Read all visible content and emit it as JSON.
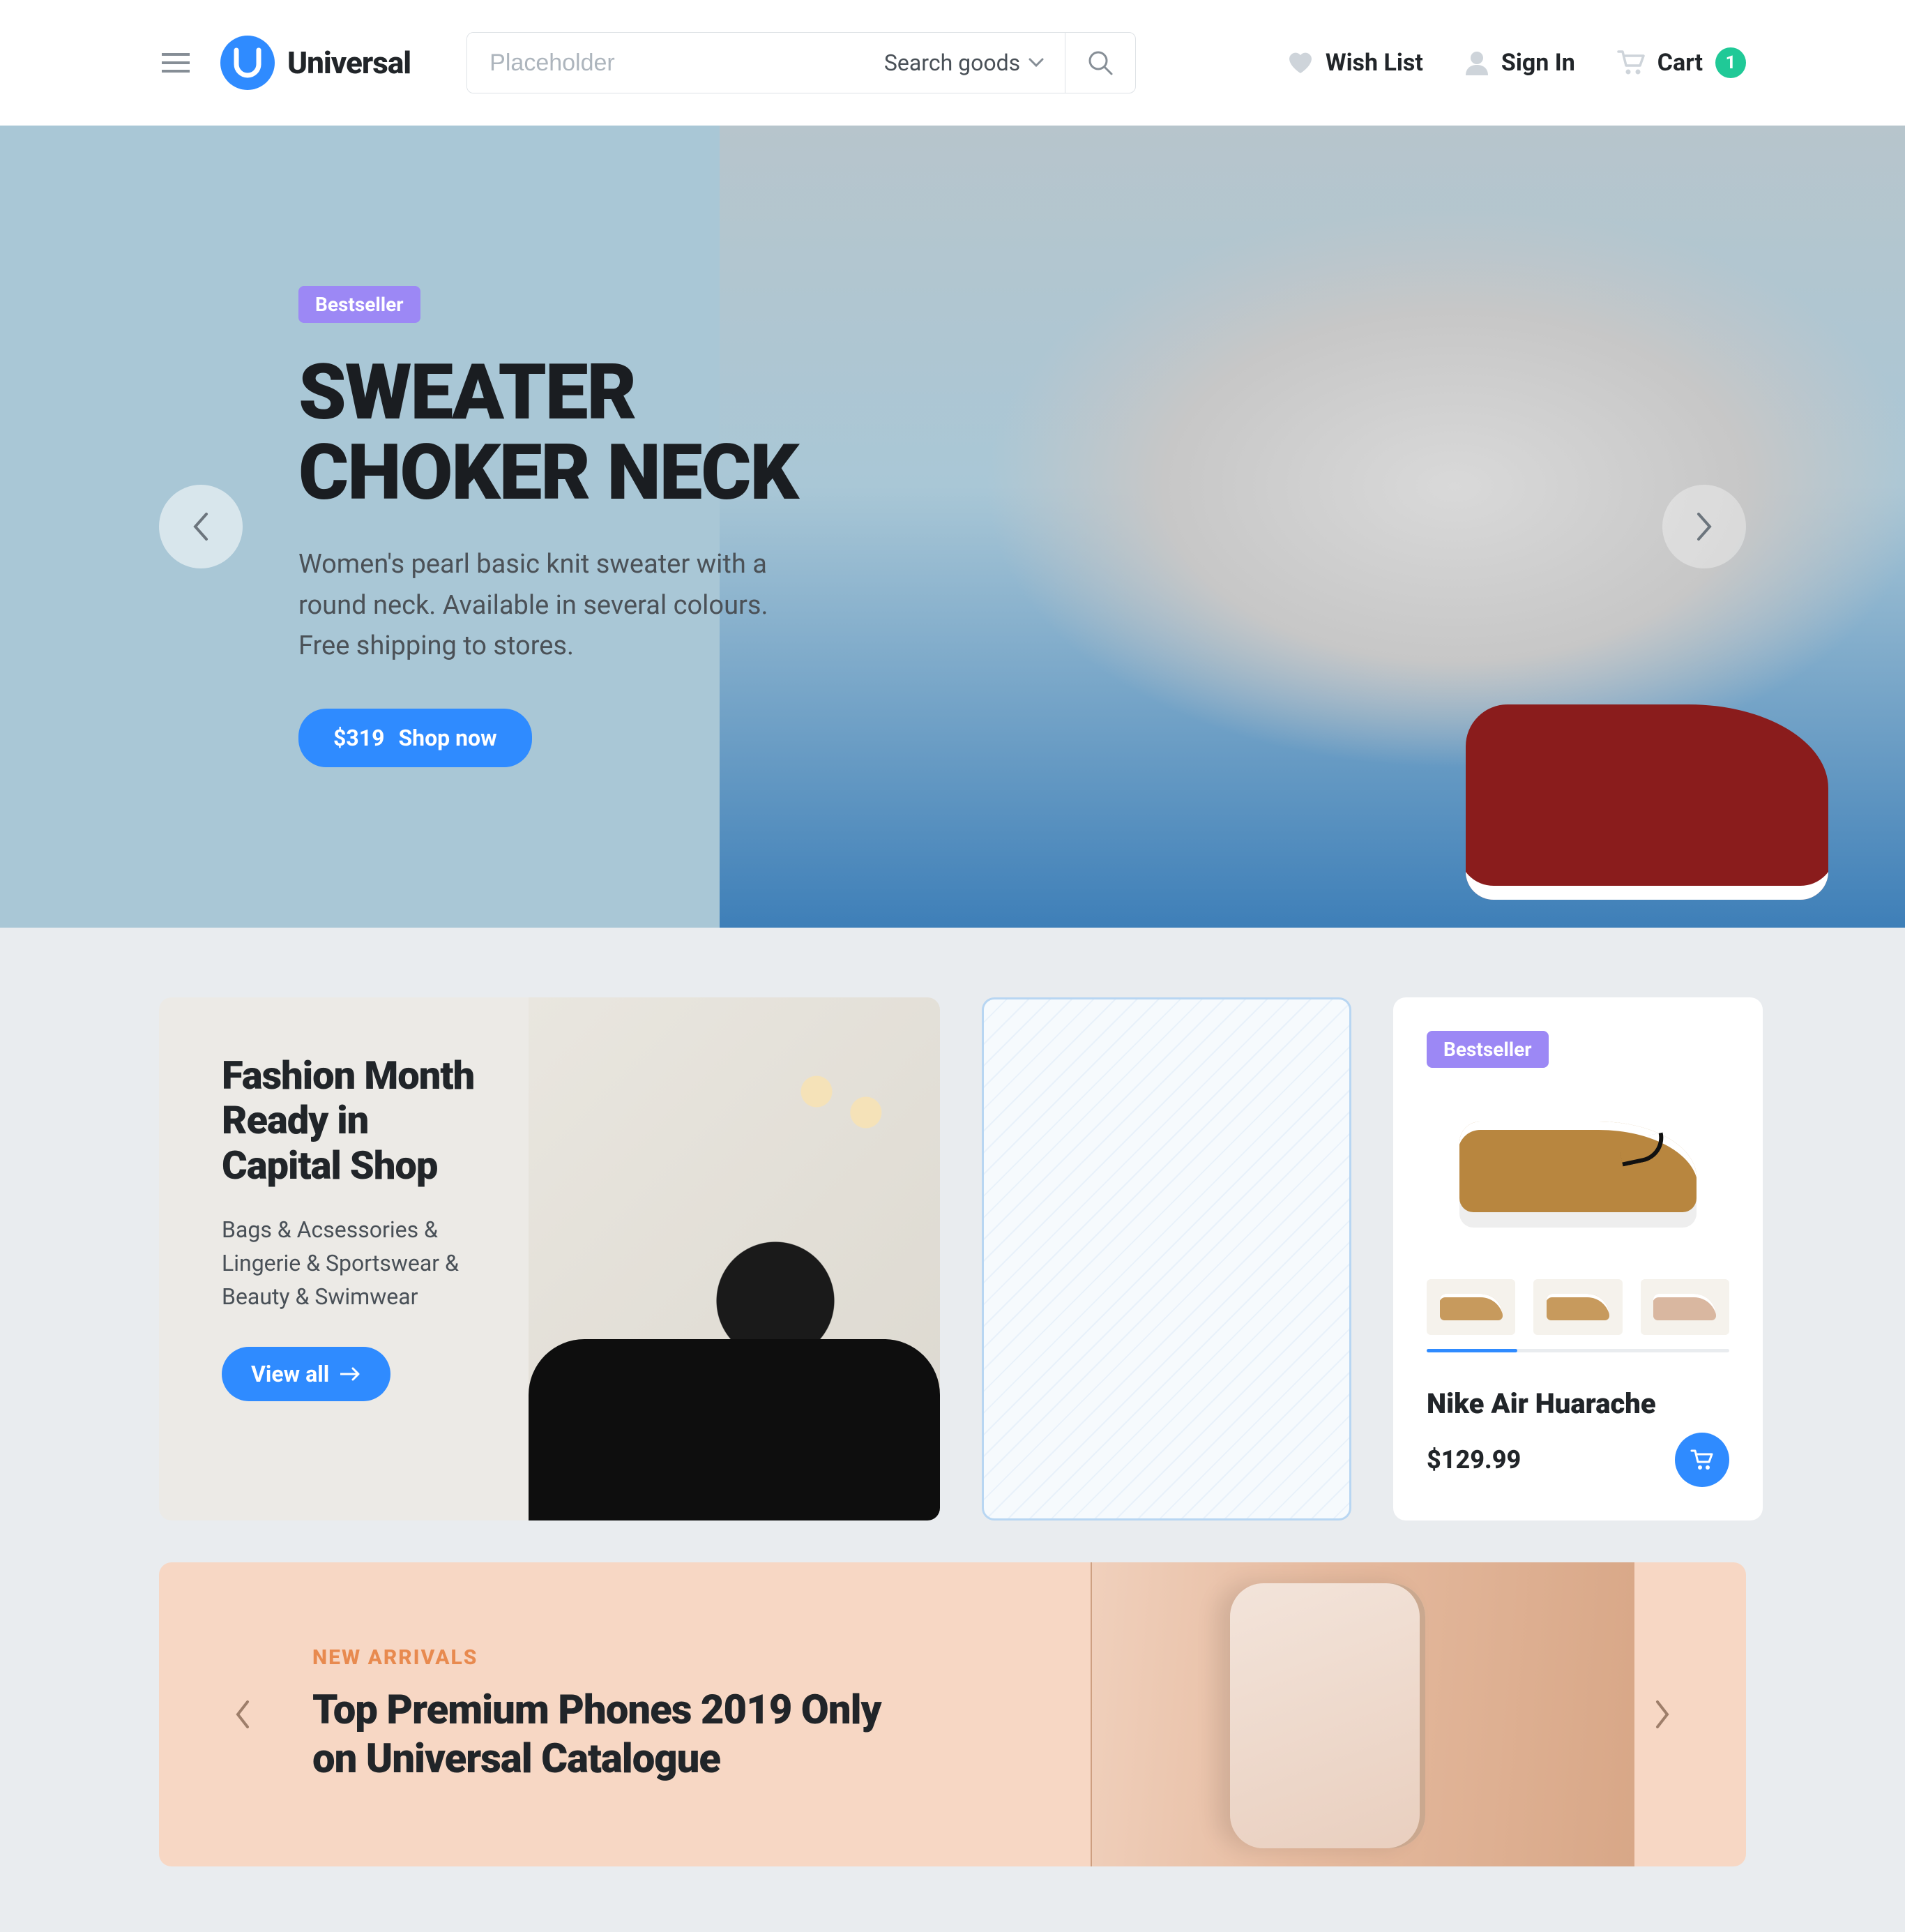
{
  "header": {
    "logo_text": "Universal",
    "search_placeholder": "Placeholder",
    "search_category": "Search goods",
    "wishlist": "Wish List",
    "signin": "Sign In",
    "cart": "Cart",
    "cart_count": "1"
  },
  "hero": {
    "badge": "Bestseller",
    "title_line1": "SWEATER",
    "title_line2": "CHOKER NECK",
    "description": "Women's pearl basic knit sweater with a round neck. Available in several colours. Free shipping to stores.",
    "price": "$319",
    "cta": "Shop now"
  },
  "promo": {
    "title": "Fashion Month Ready in Capital Shop",
    "description": "Bags & Acsessories & Lingerie & Sportswear & Beauty & Swimwear",
    "button": "View all"
  },
  "product": {
    "badge": "Bestseller",
    "name": "Nike Air Huarache",
    "price": "$129.99"
  },
  "banner": {
    "eyebrow": "NEW ARRIVALS",
    "title": "Top Premium Phones 2019 Only on Universal Catalogue"
  }
}
